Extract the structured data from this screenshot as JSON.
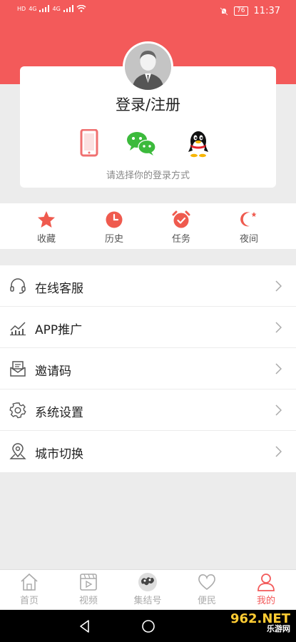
{
  "status_bar": {
    "left_labels": [
      "HD",
      "4G",
      "4G"
    ],
    "battery": "76",
    "time": "11:37"
  },
  "login": {
    "title": "登录/注册",
    "hint": "请选择你的登录方式",
    "methods": [
      "phone-icon",
      "wechat-icon",
      "qq-icon"
    ]
  },
  "quick_links": [
    {
      "label": "收藏",
      "icon": "star-icon"
    },
    {
      "label": "历史",
      "icon": "clock-icon"
    },
    {
      "label": "任务",
      "icon": "alarm-icon"
    },
    {
      "label": "夜间",
      "icon": "moon-icon"
    }
  ],
  "menu": [
    {
      "label": "在线客服",
      "icon": "headset-icon"
    },
    {
      "label": "APP推广",
      "icon": "chart-icon"
    },
    {
      "label": "邀请码",
      "icon": "envelope-icon"
    },
    {
      "label": "系统设置",
      "icon": "gear-icon"
    },
    {
      "label": "城市切换",
      "icon": "location-icon"
    }
  ],
  "tabs": [
    {
      "label": "首页",
      "icon": "home-icon",
      "active": false
    },
    {
      "label": "视频",
      "icon": "video-icon",
      "active": false
    },
    {
      "label": "集结号",
      "icon": "logo-icon",
      "active": false
    },
    {
      "label": "便民",
      "icon": "heart-icon",
      "active": false
    },
    {
      "label": "我的",
      "icon": "user-icon",
      "active": true
    }
  ],
  "watermark": {
    "top": "962.NET",
    "bottom": "乐游网"
  },
  "colors": {
    "accent": "#f35a5a",
    "background": "#ececec"
  }
}
